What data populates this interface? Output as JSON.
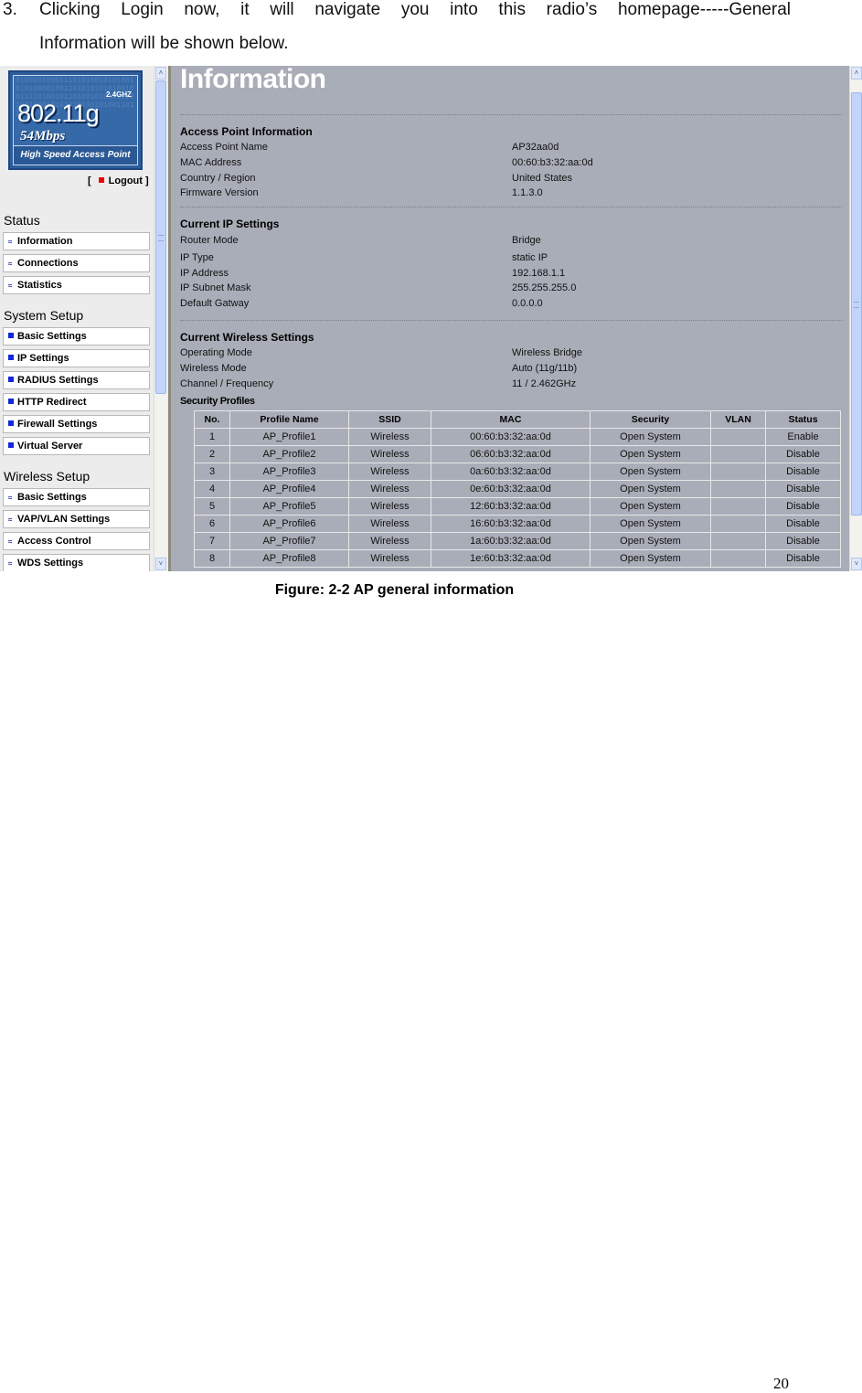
{
  "document": {
    "step_number": "3.",
    "intro_line1": "Clicking Login now, it will navigate you into this radio’s homepage-----General",
    "intro_line2": "Information will be shown below.",
    "figure_caption": "Figure: 2-2 AP general information",
    "page_number": "20"
  },
  "sidebar": {
    "logo": {
      "band": "2.4GHZ",
      "standard": "802.11g",
      "speed": "54Mbps",
      "tagline": "High Speed Access Point",
      "background_bits": "0100101000111010100101010010101000010011010101010100100111101001011010010101010101001000101011101001010011011100101010"
    },
    "logout_open": "[",
    "logout_label": "Logout",
    "logout_close": "]",
    "sections": [
      {
        "title": "Status",
        "items": [
          {
            "label": "Information",
            "icon": "feed-icon"
          },
          {
            "label": "Connections",
            "icon": "feed-icon"
          },
          {
            "label": "Statistics",
            "icon": "feed-icon"
          }
        ]
      },
      {
        "title": "System Setup",
        "items": [
          {
            "label": "Basic Settings",
            "icon": "square-icon"
          },
          {
            "label": "IP Settings",
            "icon": "square-icon"
          },
          {
            "label": "RADIUS Settings",
            "icon": "square-icon"
          },
          {
            "label": "HTTP Redirect",
            "icon": "square-icon"
          },
          {
            "label": "Firewall Settings",
            "icon": "square-icon"
          },
          {
            "label": "Virtual Server",
            "icon": "square-icon"
          }
        ]
      },
      {
        "title": "Wireless Setup",
        "items": [
          {
            "label": "Basic Settings",
            "icon": "feed-icon"
          },
          {
            "label": "VAP/VLAN Settings",
            "icon": "feed-icon"
          },
          {
            "label": "Access Control",
            "icon": "feed-icon"
          },
          {
            "label": "WDS Settings",
            "icon": "feed-icon"
          }
        ]
      }
    ]
  },
  "main": {
    "title": "Information",
    "access_point": {
      "heading": "Access Point Information",
      "rows": [
        {
          "label": "Access Point Name",
          "value": "AP32aa0d"
        },
        {
          "label": "MAC Address",
          "value": "00:60:b3:32:aa:0d"
        },
        {
          "label": "Country / Region",
          "value": "United States"
        },
        {
          "label": "Firmware Version",
          "value": "1.1.3.0"
        }
      ]
    },
    "ip_settings": {
      "heading": "Current IP Settings",
      "rows": [
        {
          "label": "Router Mode",
          "value": "Bridge"
        },
        {
          "label": "IP Type",
          "value": "static IP"
        },
        {
          "label": "IP Address",
          "value": "192.168.1.1"
        },
        {
          "label": "IP Subnet Mask",
          "value": "255.255.255.0"
        },
        {
          "label": "Default Gatway",
          "value": "0.0.0.0"
        }
      ]
    },
    "wireless_settings": {
      "heading": "Current Wireless Settings",
      "rows": [
        {
          "label": "Operating Mode",
          "value": "Wireless Bridge"
        },
        {
          "label": "Wireless Mode",
          "value": "Auto (11g/11b)"
        },
        {
          "label": "Channel / Frequency",
          "value": "11 / 2.462GHz"
        }
      ]
    },
    "security_profiles": {
      "heading": "Security Profiles",
      "columns": [
        "No.",
        "Profile Name",
        "SSID",
        "MAC",
        "Security",
        "VLAN",
        "Status"
      ],
      "rows": [
        [
          "1",
          "AP_Profile1",
          "Wireless",
          "00:60:b3:32:aa:0d",
          "Open System",
          "",
          "Enable"
        ],
        [
          "2",
          "AP_Profile2",
          "Wireless",
          "06:60:b3:32:aa:0d",
          "Open System",
          "",
          "Disable"
        ],
        [
          "3",
          "AP_Profile3",
          "Wireless",
          "0a:60:b3:32:aa:0d",
          "Open System",
          "",
          "Disable"
        ],
        [
          "4",
          "AP_Profile4",
          "Wireless",
          "0e:60:b3:32:aa:0d",
          "Open System",
          "",
          "Disable"
        ],
        [
          "5",
          "AP_Profile5",
          "Wireless",
          "12:60:b3:32:aa:0d",
          "Open System",
          "",
          "Disable"
        ],
        [
          "6",
          "AP_Profile6",
          "Wireless",
          "16:60:b3:32:aa:0d",
          "Open System",
          "",
          "Disable"
        ],
        [
          "7",
          "AP_Profile7",
          "Wireless",
          "1a:60:b3:32:aa:0d",
          "Open System",
          "",
          "Disable"
        ],
        [
          "8",
          "AP_Profile8",
          "Wireless",
          "1e:60:b3:32:aa:0d",
          "Open System",
          "",
          "Disable"
        ]
      ]
    }
  },
  "icons": {
    "scroll_up": "˄",
    "scroll_down": "˅",
    "feed": "≈"
  },
  "colors": {
    "content_bg": "#a9adb8",
    "sidebar_bg": "#ececec",
    "logo_blue": "#2d5d9b",
    "nav_square": "#1428d8",
    "logout_square": "#ee0000"
  }
}
